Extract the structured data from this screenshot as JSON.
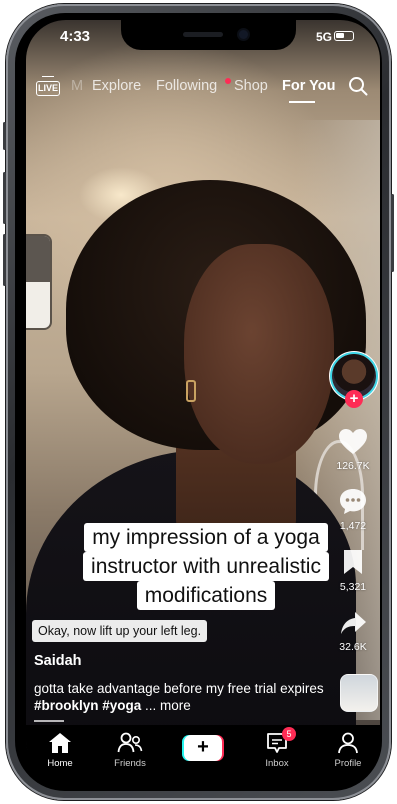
{
  "status_bar": {
    "time": "4:33",
    "network": "5G"
  },
  "top_nav": {
    "live_label": "LIVE",
    "ghost_tab": "M",
    "tabs": [
      {
        "label": "Explore"
      },
      {
        "label": "Following",
        "has_dot": true
      },
      {
        "label": "Shop"
      },
      {
        "label": "For You",
        "active": true
      }
    ]
  },
  "video": {
    "caption_lines": [
      "my impression of a yoga",
      "instructor with unrealistic",
      "modifications"
    ],
    "subtitle": "Okay, now lift up your left leg.",
    "username": "Saidah",
    "description_text": "gotta take advantage before my free trial expires ",
    "hashtags": "#brooklyn #yoga",
    "more_label": " ... more"
  },
  "actions": {
    "likes": "126.7K",
    "comments": "1,472",
    "saves": "5,321",
    "shares": "32.6K"
  },
  "bottom_nav": {
    "home": "Home",
    "friends": "Friends",
    "inbox": "Inbox",
    "inbox_badge": "5",
    "profile": "Profile"
  },
  "colors": {
    "accent_red": "#fe2c55",
    "accent_cyan": "#25f4ee"
  },
  "icons": [
    "live-icon",
    "search-icon",
    "heart-icon",
    "comment-icon",
    "bookmark-icon",
    "share-icon",
    "home-icon",
    "friends-icon",
    "create-icon",
    "inbox-icon",
    "profile-icon"
  ]
}
